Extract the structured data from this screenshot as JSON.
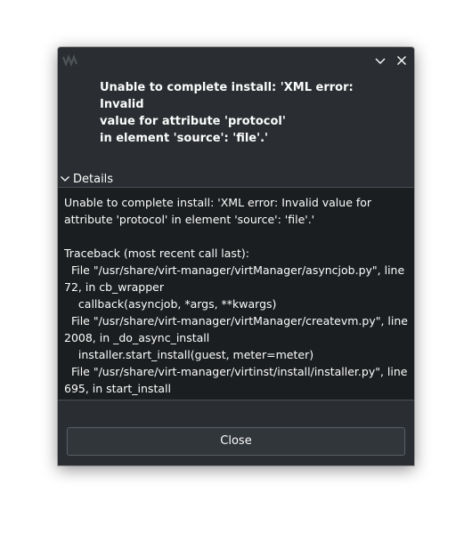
{
  "window": {
    "icon": "virt-manager-app-icon",
    "minimize_icon": "chevron-down-icon",
    "close_icon": "close-icon"
  },
  "message": {
    "text": "Unable to complete install: 'XML error: Invalid\nvalue for attribute 'protocol'\nin element 'source': 'file'.'"
  },
  "details": {
    "label": "Details",
    "expanded": true,
    "text": "Unable to complete install: 'XML error: Invalid value for attribute 'protocol' in element 'source': 'file'.'\n\nTraceback (most recent call last):\n  File \"/usr/share/virt-manager/virtManager/asyncjob.py\", line 72, in cb_wrapper\n    callback(asyncjob, *args, **kwargs)\n  File \"/usr/share/virt-manager/virtManager/createvm.py\", line 2008, in _do_async_install\n    installer.start_install(guest, meter=meter)\n  File \"/usr/share/virt-manager/virtinst/install/installer.py\", line 695, in start_install"
  },
  "buttons": {
    "close_label": "Close"
  },
  "colors": {
    "dialog_bg": "#2a2e32",
    "details_bg": "#1b1e20",
    "text": "#fcfcfc"
  }
}
